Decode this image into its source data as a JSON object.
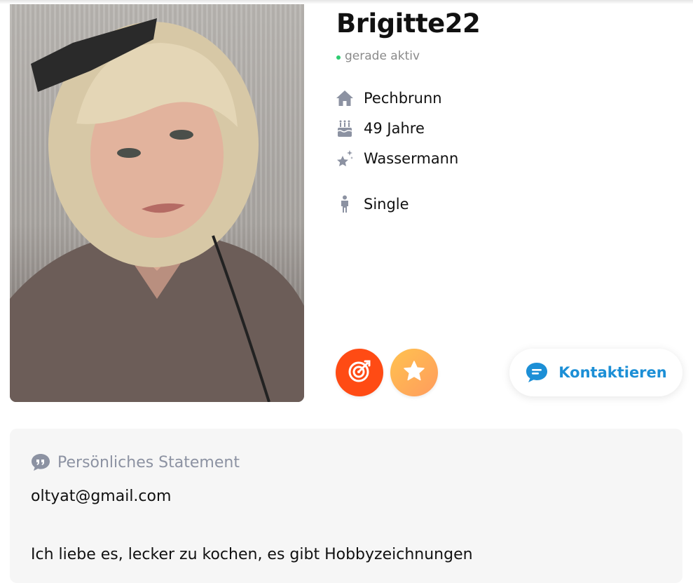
{
  "profile": {
    "username": "Brigitte22",
    "status": "gerade aktiv",
    "location": "Pechbrunn",
    "age": "49 Jahre",
    "zodiac": "Wassermann",
    "relationship": "Single"
  },
  "actions": {
    "contact_label": "Kontaktieren"
  },
  "statement": {
    "heading": "Persönliches Statement",
    "email": "oltyat@gmail.com",
    "text": "Ich liebe es, lecker zu kochen, es gibt Hobbyzeichnungen"
  },
  "icons": {
    "location": "home-icon",
    "age": "birthday-cake-icon",
    "zodiac": "sparkle-star-icon",
    "relationship": "person-icon",
    "target": "target-icon",
    "favorite": "star-icon",
    "contact": "chat-bubble-icon",
    "statement": "quote-bubble-icon"
  },
  "colors": {
    "online": "#2ecc71",
    "accent_blue": "#1c8fd6",
    "target_red": "#ff4b14",
    "star_orange": "#ffb35a",
    "muted_icon": "#8c92a2"
  }
}
